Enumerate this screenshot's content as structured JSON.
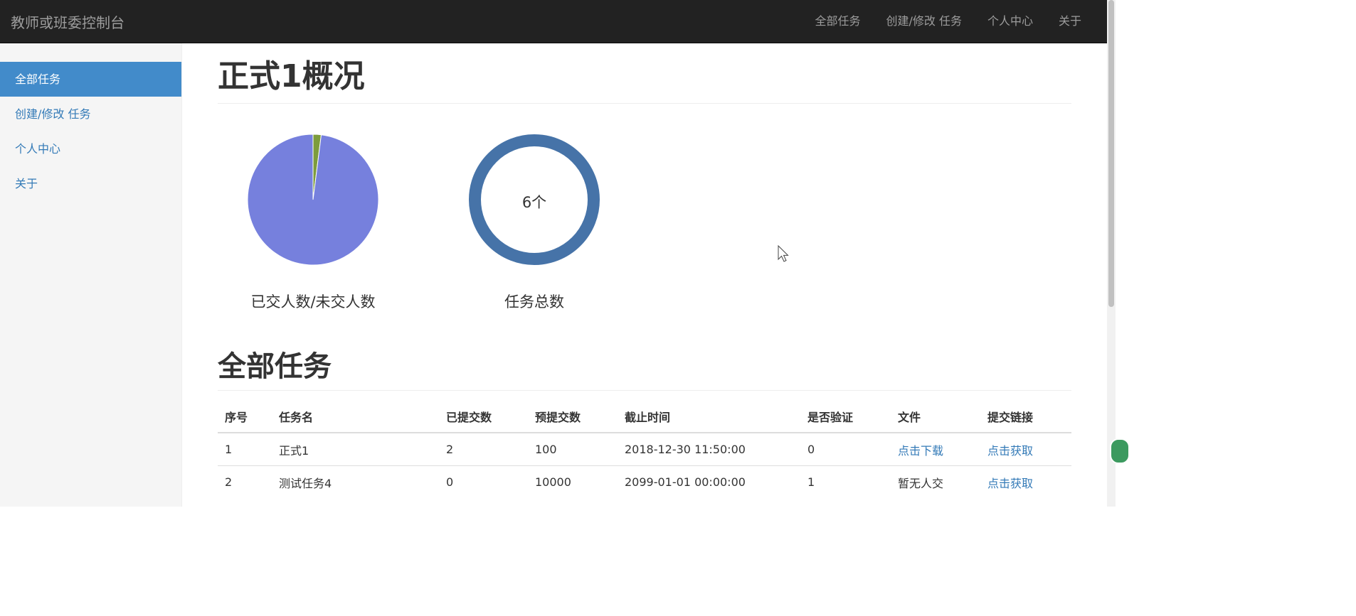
{
  "navbar": {
    "brand": "教师或班委控制台",
    "links": [
      "全部任务",
      "创建/修改 任务",
      "个人中心",
      "关于"
    ]
  },
  "sidebar": {
    "items": [
      {
        "label": "全部任务",
        "active": true
      },
      {
        "label": "创建/修改 任务",
        "active": false
      },
      {
        "label": "个人中心",
        "active": false
      },
      {
        "label": "关于",
        "active": false
      }
    ]
  },
  "main": {
    "overview_title": "正式1概况",
    "tasks_title": "全部任务"
  },
  "chart_data": [
    {
      "type": "pie",
      "title": "已交人数/未交人数",
      "slices": [
        {
          "label": "已交人数",
          "value": 2,
          "color": "#7d9c3c"
        },
        {
          "label": "未交人数",
          "value": 98,
          "color": "#7680dd"
        }
      ]
    },
    {
      "type": "pie",
      "title": "任务总数",
      "center_text": "6个",
      "slices": [
        {
          "label": "任务总数",
          "value": 6,
          "color": "#4673a8"
        }
      ]
    }
  ],
  "table": {
    "headers": [
      "序号",
      "任务名",
      "已提交数",
      "预提交数",
      "截止时间",
      "是否验证",
      "文件",
      "提交链接"
    ],
    "rows": [
      [
        "1",
        "正式1",
        "2",
        "100",
        "2018-12-30 11:50:00",
        "0",
        "点击下载",
        "点击获取"
      ],
      [
        "2",
        "测试任务4",
        "0",
        "10000",
        "2099-01-01 00:00:00",
        "1",
        "暂无人交",
        "点击获取"
      ]
    ]
  }
}
